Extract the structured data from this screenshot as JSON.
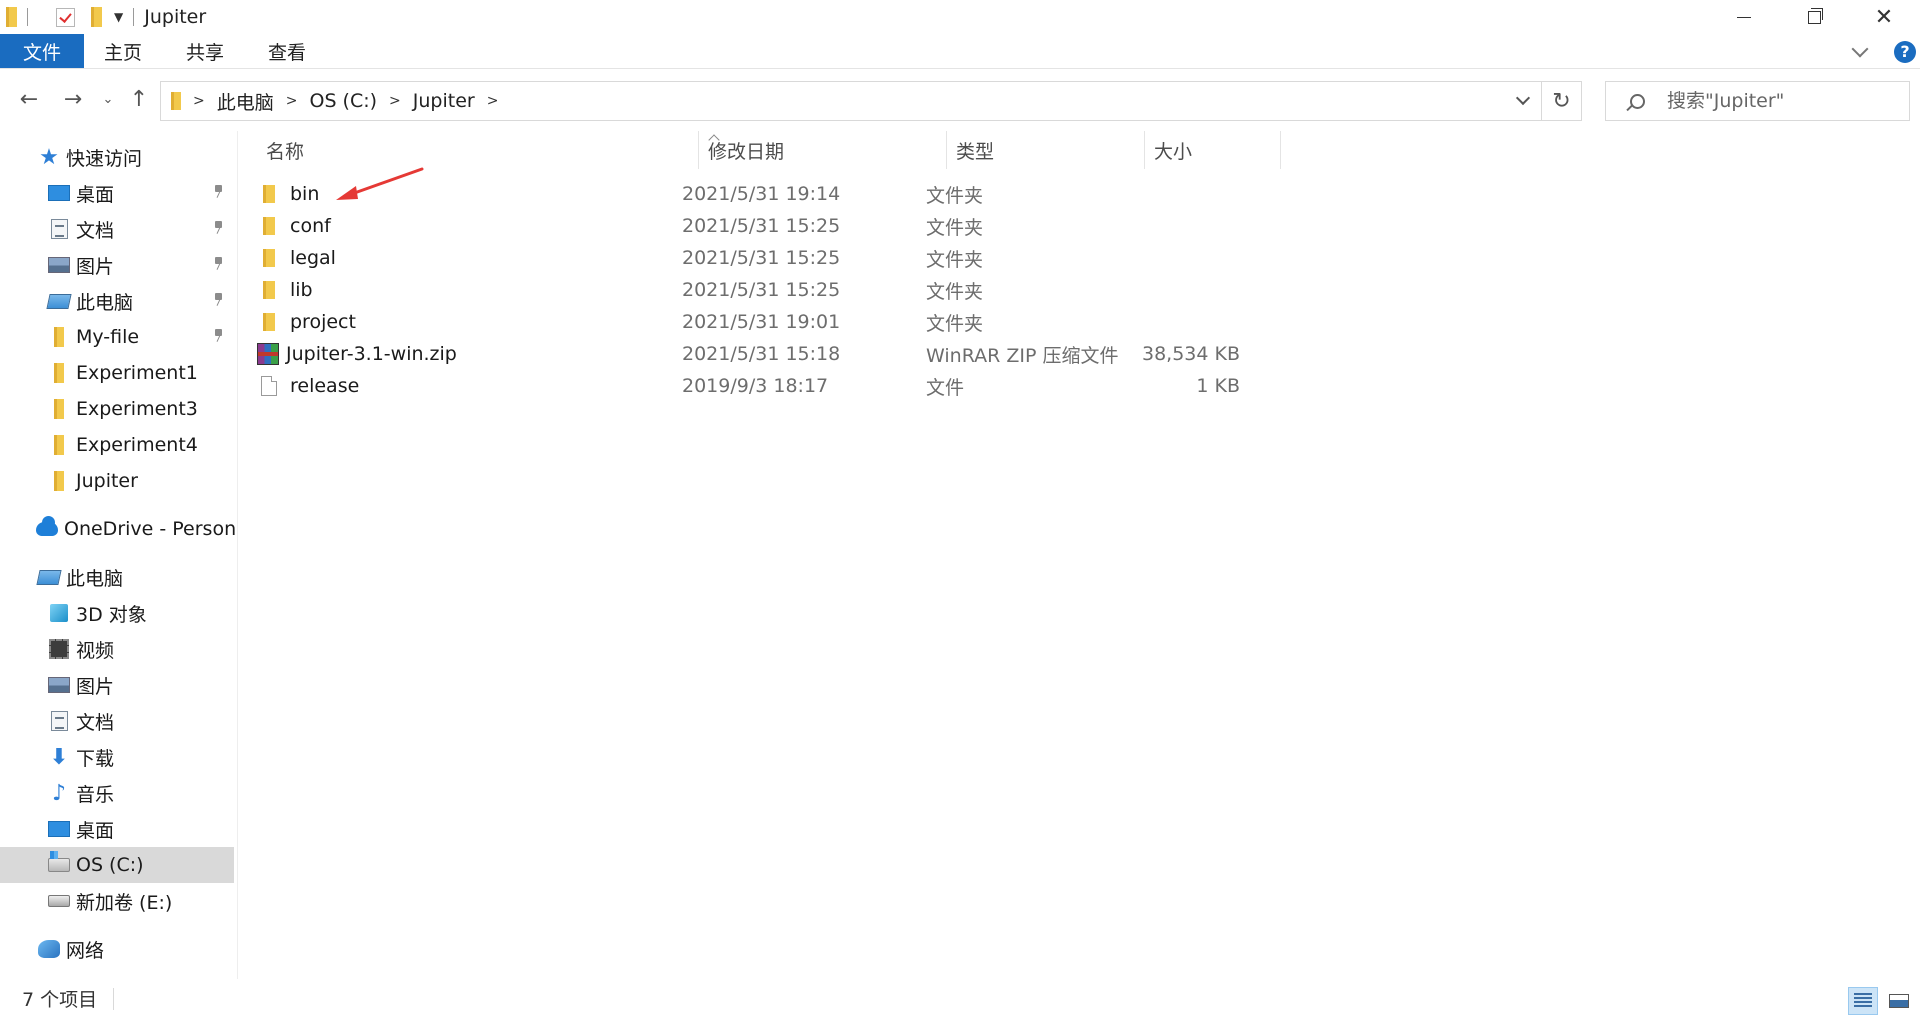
{
  "window": {
    "title": "Jupiter",
    "minimize": "minimize",
    "restore": "restore",
    "close": "✕"
  },
  "ribbon": {
    "tabs": [
      {
        "label": "文件"
      },
      {
        "label": "主页"
      },
      {
        "label": "共享"
      },
      {
        "label": "查看"
      }
    ],
    "help": "?"
  },
  "address": {
    "crumbs": [
      "此电脑",
      "OS (C:)",
      "Jupiter"
    ],
    "refresh": "↻"
  },
  "search": {
    "placeholder": "搜索\"Jupiter\""
  },
  "sidebar": {
    "items": [
      {
        "label": "快速访问",
        "icon": "star-icon",
        "pinned": false
      },
      {
        "label": "桌面",
        "icon": "desktop-icon",
        "pinned": true
      },
      {
        "label": "文档",
        "icon": "document-icon",
        "pinned": true
      },
      {
        "label": "图片",
        "icon": "pictures-icon",
        "pinned": true
      },
      {
        "label": "此电脑",
        "icon": "computer-icon",
        "pinned": true
      },
      {
        "label": "My-file",
        "icon": "folder-icon",
        "pinned": true
      },
      {
        "label": "Experiment1",
        "icon": "folder-icon",
        "pinned": false
      },
      {
        "label": "Experiment3",
        "icon": "folder-icon",
        "pinned": false
      },
      {
        "label": "Experiment4",
        "icon": "folder-icon",
        "pinned": false
      },
      {
        "label": "Jupiter",
        "icon": "folder-icon",
        "pinned": false
      },
      {
        "label": "OneDrive - Personal",
        "icon": "onedrive-icon",
        "pinned": false
      },
      {
        "label": "此电脑",
        "icon": "computer-icon",
        "pinned": false
      },
      {
        "label": "3D 对象",
        "icon": "3d-objects-icon",
        "pinned": false
      },
      {
        "label": "视频",
        "icon": "videos-icon",
        "pinned": false
      },
      {
        "label": "图片",
        "icon": "pictures-icon",
        "pinned": false
      },
      {
        "label": "文档",
        "icon": "document-icon",
        "pinned": false
      },
      {
        "label": "下载",
        "icon": "download-icon",
        "pinned": false
      },
      {
        "label": "音乐",
        "icon": "music-icon",
        "pinned": false
      },
      {
        "label": "桌面",
        "icon": "desktop-icon",
        "pinned": false
      },
      {
        "label": "OS (C:)",
        "icon": "drive-c-icon",
        "pinned": false,
        "selected": true
      },
      {
        "label": "新加卷 (E:)",
        "icon": "drive-icon",
        "pinned": false
      },
      {
        "label": "网络",
        "icon": "network-icon",
        "pinned": false
      }
    ]
  },
  "filelist": {
    "columns": {
      "name": "名称",
      "date": "修改日期",
      "type": "类型",
      "size": "大小"
    },
    "rows": [
      {
        "name": "bin",
        "date": "2021/5/31 19:14",
        "type": "文件夹",
        "size": "",
        "icon": "folder-icon"
      },
      {
        "name": "conf",
        "date": "2021/5/31 15:25",
        "type": "文件夹",
        "size": "",
        "icon": "folder-icon"
      },
      {
        "name": "legal",
        "date": "2021/5/31 15:25",
        "type": "文件夹",
        "size": "",
        "icon": "folder-icon"
      },
      {
        "name": "lib",
        "date": "2021/5/31 15:25",
        "type": "文件夹",
        "size": "",
        "icon": "folder-icon"
      },
      {
        "name": "project",
        "date": "2021/5/31 19:01",
        "type": "文件夹",
        "size": "",
        "icon": "folder-icon"
      },
      {
        "name": "Jupiter-3.1-win.zip",
        "date": "2021/5/31 15:18",
        "type": "WinRAR ZIP 压缩文件",
        "size": "38,534 KB",
        "icon": "winrar-zip-icon"
      },
      {
        "name": "release",
        "date": "2019/9/3 18:17",
        "type": "文件",
        "size": "1 KB",
        "icon": "file-icon"
      }
    ]
  },
  "status": {
    "item_count": "7 个项目"
  },
  "colors": {
    "accent": "#1a6cc0",
    "annotation_arrow": "#e53935",
    "selected_bg": "#d9d9d9"
  }
}
